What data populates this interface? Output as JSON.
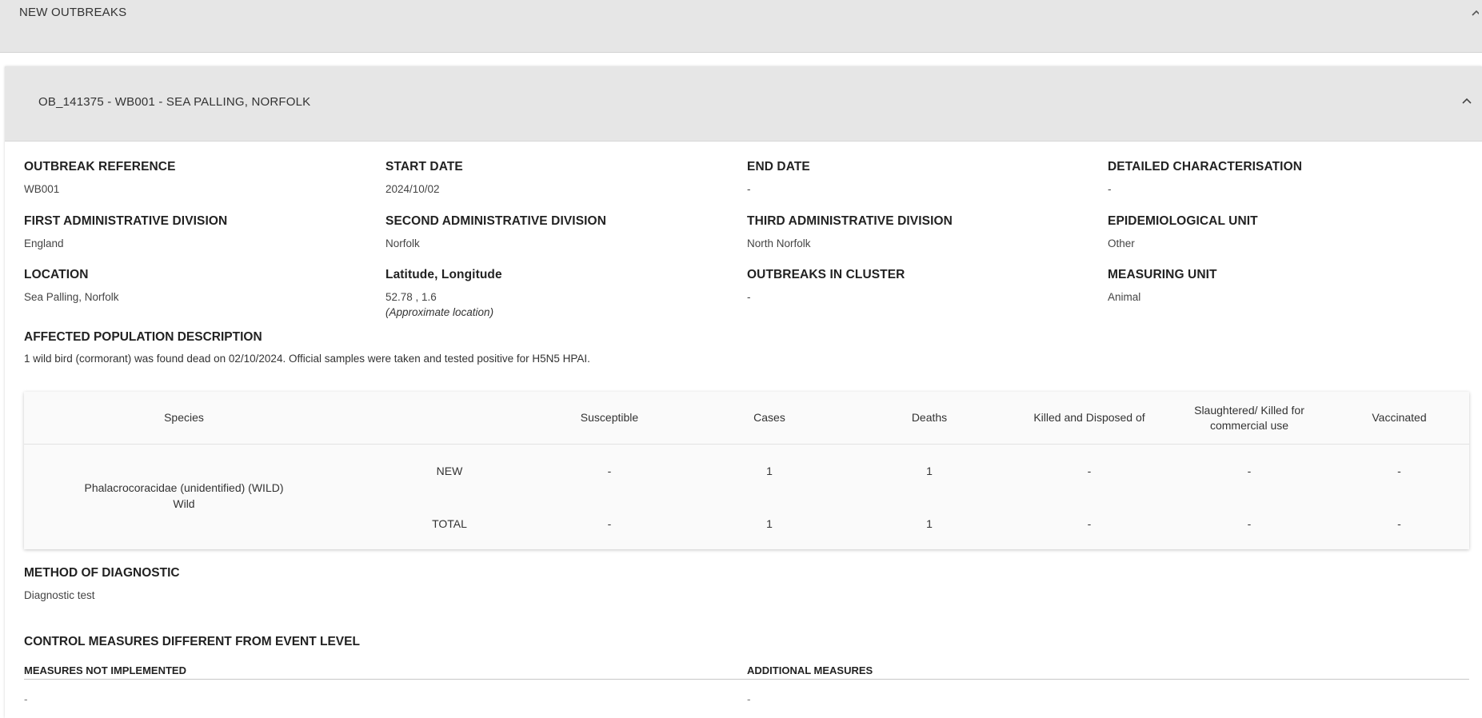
{
  "new_outbreaks": {
    "title": "NEW OUTBREAKS"
  },
  "outbreak": {
    "header": "OB_141375 - WB001 - SEA PALLING, NORFOLK",
    "fields": {
      "outbreak_reference": {
        "label": "OUTBREAK REFERENCE",
        "value": "WB001"
      },
      "start_date": {
        "label": "START DATE",
        "value": "2024/10/02"
      },
      "end_date": {
        "label": "END DATE",
        "value": "-"
      },
      "detailed_characterisation": {
        "label": "DETAILED CHARACTERISATION",
        "value": "-"
      },
      "first_admin_division": {
        "label": "FIRST ADMINISTRATIVE DIVISION",
        "value": "England"
      },
      "second_admin_division": {
        "label": "SECOND ADMINISTRATIVE DIVISION",
        "value": "Norfolk"
      },
      "third_admin_division": {
        "label": "THIRD ADMINISTRATIVE DIVISION",
        "value": "North Norfolk"
      },
      "epidemiological_unit": {
        "label": "EPIDEMIOLOGICAL UNIT",
        "value": "Other"
      },
      "location": {
        "label": "LOCATION",
        "value": "Sea Palling, Norfolk"
      },
      "lat_long": {
        "label": "Latitude, Longitude",
        "value": "52.78 , 1.6",
        "note": "(Approximate location)"
      },
      "outbreaks_in_cluster": {
        "label": "OUTBREAKS IN CLUSTER",
        "value": "-"
      },
      "measuring_unit": {
        "label": "MEASURING UNIT",
        "value": "Animal"
      }
    },
    "affected_population": {
      "label": "AFFECTED POPULATION DESCRIPTION",
      "text": "1 wild bird (cormorant) was found dead on 02/10/2024. Official samples were taken and tested positive for H5N5 HPAI."
    },
    "table": {
      "headers": [
        "Species",
        "Susceptible",
        "Cases",
        "Deaths",
        "Killed and Disposed of",
        "Slaughtered/ Killed for commercial use",
        "Vaccinated"
      ],
      "species_name": "Phalacrocoracidae (unidentified) (WILD)",
      "species_type": "Wild",
      "rows": [
        {
          "label": "NEW",
          "values": [
            "-",
            "1",
            "1",
            "-",
            "-",
            "-"
          ]
        },
        {
          "label": "TOTAL",
          "values": [
            "-",
            "1",
            "1",
            "-",
            "-",
            "-"
          ]
        }
      ]
    },
    "method_of_diagnostic": {
      "label": "METHOD OF DIAGNOSTIC",
      "value": "Diagnostic test"
    },
    "control_measures": {
      "label": "CONTROL MEASURES DIFFERENT FROM EVENT LEVEL",
      "not_implemented": {
        "label": "MEASURES NOT IMPLEMENTED",
        "value": "-"
      },
      "additional": {
        "label": "ADDITIONAL MEASURES",
        "value": "-"
      }
    }
  }
}
